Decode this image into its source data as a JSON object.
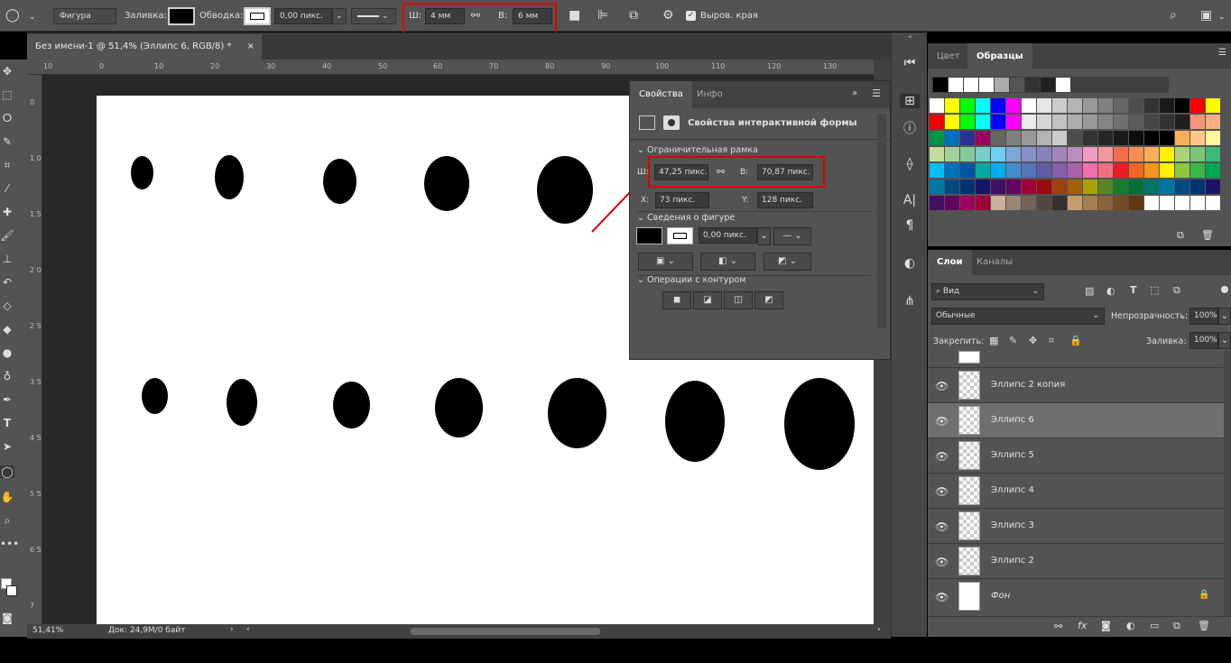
{
  "options_bar": {
    "shape_mode": "Фигура",
    "fill_label": "Заливка:",
    "stroke_label": "Обводка:",
    "stroke_width": "0,00 пикс.",
    "width_label": "Ш:",
    "width_value": "4 мм",
    "height_label": "В:",
    "height_value": "6 мм",
    "align_edges_label": "Выров. края"
  },
  "document_tab": {
    "title": "Без имени-1 @ 51,4% (Эллипс 6, RGB/8) *",
    "close": "×"
  },
  "ruler_h": [
    "10",
    "0",
    "10",
    "20",
    "30",
    "40",
    "50",
    "60",
    "70",
    "80",
    "90",
    "100",
    "110",
    "120",
    "130"
  ],
  "ruler_v": [
    "0",
    "1 0",
    "1 5",
    "2 0",
    "2 5",
    "3",
    "3 5",
    "4",
    "4 5",
    "5",
    "5 5",
    "6",
    "6 5",
    "7"
  ],
  "status_bar": {
    "zoom": "51,41%",
    "doc": "Док: 24,9M/0 байт"
  },
  "properties_panel": {
    "tabs": [
      "Свойства",
      "Инфо"
    ],
    "header": "Свойства интерактивной формы",
    "section_bounding": "Ограничительная рамка",
    "w_label": "Ш:",
    "w_value": "47,25 пикс.",
    "h_label": "В:",
    "h_value": "70,87 пикс.",
    "x_label": "X:",
    "x_value": "73 пикс.",
    "y_label": "Y:",
    "y_value": "128 пикс.",
    "section_shape": "Сведения о фигуре",
    "stroke_value": "0,00 пикс.",
    "section_path_ops": "Операции с контуром"
  },
  "swatches_panel": {
    "tabs": [
      "Цвет",
      "Образцы"
    ],
    "rows": [
      [
        "#ffffff",
        "#fefe00",
        "#00ff00",
        "#00ffff",
        "#0000ff",
        "#ff00ff",
        "#ffffff",
        "#e6e6e6",
        "#cccccc",
        "#b3b3b3",
        "#999999",
        "#808080",
        "#666666",
        "#4d4d4d",
        "#333333",
        "#1a1a1a",
        "#000000",
        "#ff0000",
        "#ffff00"
      ],
      [
        "#f00000",
        "#ffff00",
        "#00ff00",
        "#00ffff",
        "#0000ff",
        "#ff00ff",
        "#ebebeb",
        "#d6d6d6",
        "#c2c2c2",
        "#adadad",
        "#999999",
        "#858585",
        "#707070",
        "#5c5c5c",
        "#474747",
        "#333333",
        "#1f1f1f",
        "#f69679",
        "#f9ad81"
      ],
      [
        "#009245",
        "#0071bc",
        "#2e3192",
        "#9e005d",
        "#666666",
        "#808080",
        "#999999",
        "#b3b3b3",
        "#cccccc",
        "#4d4d4d",
        "#333333",
        "#262626",
        "#1a1a1a",
        "#0d0d0d",
        "#000000",
        "#000000",
        "#fbaf5d",
        "#fdc689",
        "#fff799"
      ],
      [
        "#c4df9b",
        "#a3d39c",
        "#82ca9c",
        "#7accc8",
        "#6dcff6",
        "#7da7d9",
        "#8393ca",
        "#8781bd",
        "#a186be",
        "#bd8cbf",
        "#f49ac1",
        "#f5989d",
        "#f26c4f",
        "#f68e56",
        "#fbaf5d",
        "#fff200",
        "#acd373",
        "#7cc576",
        "#3bb878"
      ],
      [
        "#00bff3",
        "#0072bc",
        "#0054a6",
        "#00a99d",
        "#00aeef",
        "#448ccb",
        "#5674b9",
        "#605ca8",
        "#855fa8",
        "#a763a8",
        "#f06eaa",
        "#f26d7d",
        "#ed1c24",
        "#f26522",
        "#f7941d",
        "#fff200",
        "#8dc63f",
        "#39b54a",
        "#00a651"
      ],
      [
        "#0076a3",
        "#004a80",
        "#003471",
        "#1b1464",
        "#440e62",
        "#630460",
        "#9e0039",
        "#9e0b0f",
        "#a0410d",
        "#a36209",
        "#aba000",
        "#598527",
        "#197b30",
        "#007236",
        "#00746b",
        "#0076a3",
        "#004a80",
        "#003471",
        "#1b1464"
      ],
      [
        "#440e62",
        "#630460",
        "#9e005d",
        "#9e0039",
        "#c7b299",
        "#998675",
        "#736357",
        "#534741",
        "#37302d",
        "#c69c6d",
        "#a67c52",
        "#8c6239",
        "#754c24",
        "#603913",
        "#ffffff",
        "#ffffff",
        "#ffffff",
        "#ffffff",
        "#ffffff"
      ]
    ]
  },
  "layers_panel": {
    "tabs": [
      "Слои",
      "Каналы"
    ],
    "filter": "Вид",
    "blend_mode": "Обычные",
    "opacity_label": "Непрозрачность:",
    "opacity_value": "100%",
    "lock_label": "Закрепить:",
    "fill_label": "Заливка:",
    "fill_value": "100%",
    "layers": [
      {
        "name": "Эллипс 2 копия",
        "selected": false
      },
      {
        "name": "Эллипс 6",
        "selected": true
      },
      {
        "name": "Эллипс 5",
        "selected": false
      },
      {
        "name": "Эллипс 4",
        "selected": false
      },
      {
        "name": "Эллипс 3",
        "selected": false
      },
      {
        "name": "Эллипс 2",
        "selected": false
      },
      {
        "name": "Фон",
        "selected": false,
        "background": true
      }
    ]
  },
  "colors": {
    "highlight": "#e00000",
    "panel_bg": "#535353",
    "canvas": "#ffffff"
  }
}
